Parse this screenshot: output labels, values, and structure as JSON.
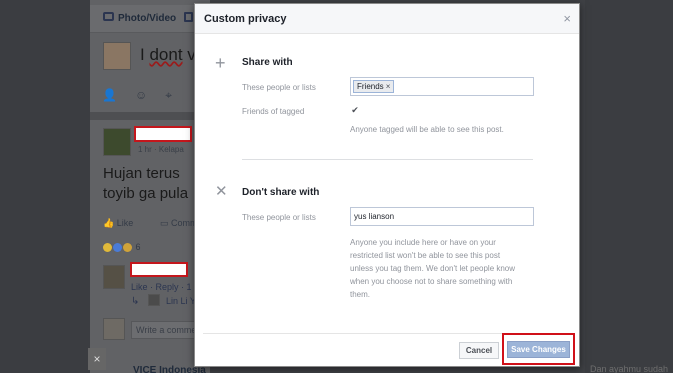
{
  "background": {
    "composer": {
      "photo_video_label": "Photo/Video",
      "draft_text_start": "I ",
      "draft_text_word": "dont",
      "draft_text_end": " v"
    },
    "post": {
      "time_text": "1 hr · Kelapa",
      "text": "Hujan terus toyib ga pula",
      "like_label": "Like",
      "comment_label": "Comme",
      "reaction_count": "6"
    },
    "comment": {
      "actions": "Like · Reply · 1",
      "reply_author": "Lin Li Y",
      "write_placeholder": "Write a comme"
    },
    "next_post_author": "VICE Indonesia",
    "close_x": "×",
    "right_text": "Dan ayahmu sudah ada dalam"
  },
  "modal": {
    "title": "Custom privacy",
    "close_icon": "×",
    "share_with": {
      "icon": "+",
      "title": "Share with",
      "people_label": "These people or lists",
      "token": "Friends",
      "token_remove": "×",
      "tagged_label": "Friends of tagged",
      "tagged_checked": true,
      "check_glyph": "✔",
      "hint": "Anyone tagged will be able to see this post."
    },
    "dont_share_with": {
      "icon": "✕",
      "title": "Don't share with",
      "people_label": "These people or lists",
      "value": "yus lianson",
      "hint": [
        "Anyone you include here or have on your",
        "restricted list won't be able to see this post",
        "unless you tag them. We don't let people know",
        "when you choose not to share something with",
        "them."
      ]
    },
    "footer": {
      "cancel_label": "Cancel",
      "save_label": "Save Changes"
    }
  },
  "colors": {
    "highlight_border": "#d01019",
    "save_button": "#9cb4d8",
    "overlay": "#3f4145"
  }
}
